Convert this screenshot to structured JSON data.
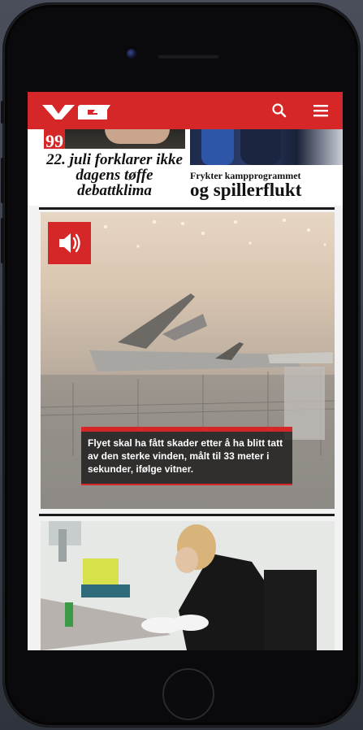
{
  "app": {
    "brand": "VG",
    "accent_color": "#d52727"
  },
  "header": {
    "logo_text": "VG",
    "search_icon": "search-icon",
    "menu_icon": "hamburger-menu-icon"
  },
  "teasers": [
    {
      "badge": "99",
      "title": "22. juli forklarer ikke dagens tøffe debattklima"
    },
    {
      "kicker": "Frykter kampprogrammet",
      "title": "og spillerflukt"
    }
  ],
  "video": {
    "sound_icon": "speaker-volume-icon",
    "caption": "Flyet skal ha fått skader etter å ha blitt tatt av den sterke vinden, målt til 33 meter i sekunder, ifølge vitner."
  }
}
